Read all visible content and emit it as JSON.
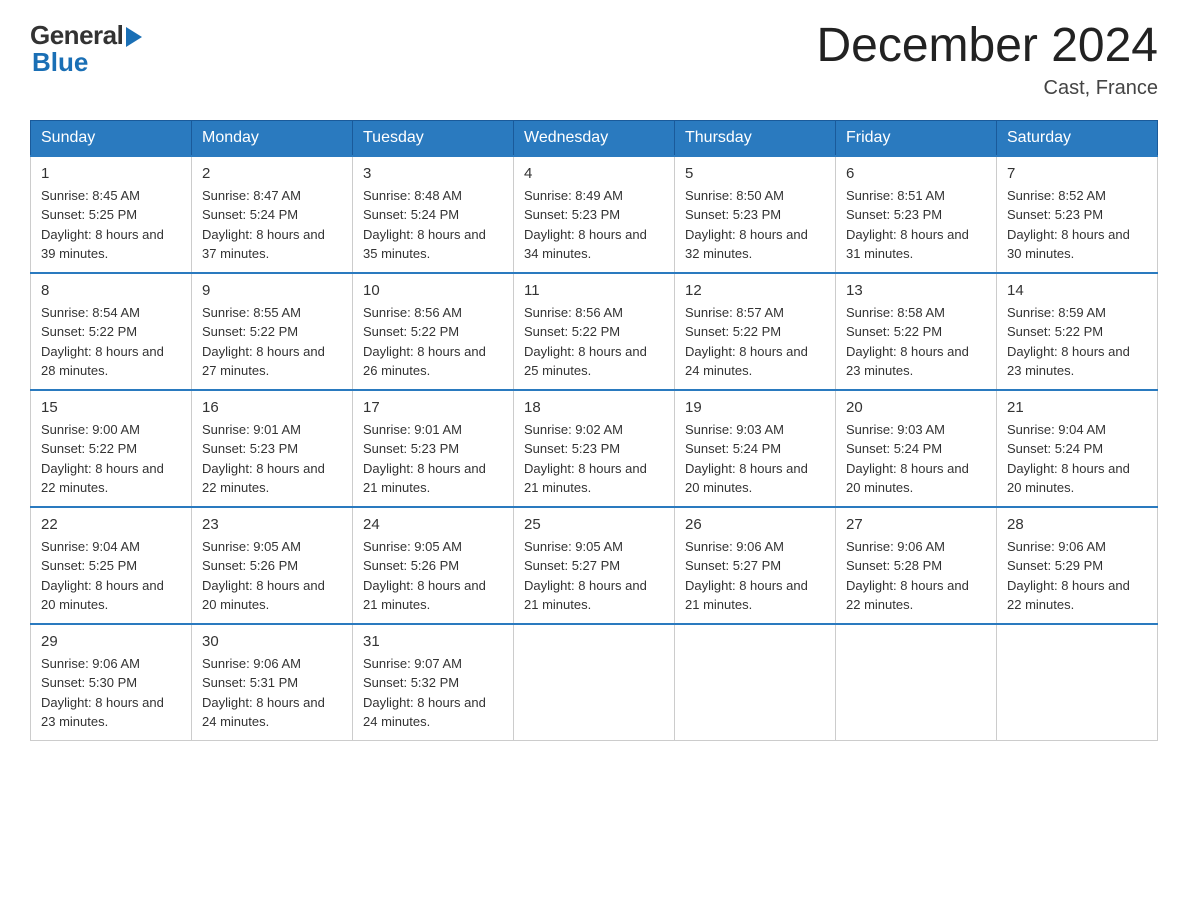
{
  "header": {
    "logo_general": "General",
    "logo_blue": "Blue",
    "month_title": "December 2024",
    "location": "Cast, France"
  },
  "days_of_week": [
    "Sunday",
    "Monday",
    "Tuesday",
    "Wednesday",
    "Thursday",
    "Friday",
    "Saturday"
  ],
  "weeks": [
    [
      {
        "day": "1",
        "sunrise": "8:45 AM",
        "sunset": "5:25 PM",
        "daylight": "8 hours and 39 minutes."
      },
      {
        "day": "2",
        "sunrise": "8:47 AM",
        "sunset": "5:24 PM",
        "daylight": "8 hours and 37 minutes."
      },
      {
        "day": "3",
        "sunrise": "8:48 AM",
        "sunset": "5:24 PM",
        "daylight": "8 hours and 35 minutes."
      },
      {
        "day": "4",
        "sunrise": "8:49 AM",
        "sunset": "5:23 PM",
        "daylight": "8 hours and 34 minutes."
      },
      {
        "day": "5",
        "sunrise": "8:50 AM",
        "sunset": "5:23 PM",
        "daylight": "8 hours and 32 minutes."
      },
      {
        "day": "6",
        "sunrise": "8:51 AM",
        "sunset": "5:23 PM",
        "daylight": "8 hours and 31 minutes."
      },
      {
        "day": "7",
        "sunrise": "8:52 AM",
        "sunset": "5:23 PM",
        "daylight": "8 hours and 30 minutes."
      }
    ],
    [
      {
        "day": "8",
        "sunrise": "8:54 AM",
        "sunset": "5:22 PM",
        "daylight": "8 hours and 28 minutes."
      },
      {
        "day": "9",
        "sunrise": "8:55 AM",
        "sunset": "5:22 PM",
        "daylight": "8 hours and 27 minutes."
      },
      {
        "day": "10",
        "sunrise": "8:56 AM",
        "sunset": "5:22 PM",
        "daylight": "8 hours and 26 minutes."
      },
      {
        "day": "11",
        "sunrise": "8:56 AM",
        "sunset": "5:22 PM",
        "daylight": "8 hours and 25 minutes."
      },
      {
        "day": "12",
        "sunrise": "8:57 AM",
        "sunset": "5:22 PM",
        "daylight": "8 hours and 24 minutes."
      },
      {
        "day": "13",
        "sunrise": "8:58 AM",
        "sunset": "5:22 PM",
        "daylight": "8 hours and 23 minutes."
      },
      {
        "day": "14",
        "sunrise": "8:59 AM",
        "sunset": "5:22 PM",
        "daylight": "8 hours and 23 minutes."
      }
    ],
    [
      {
        "day": "15",
        "sunrise": "9:00 AM",
        "sunset": "5:22 PM",
        "daylight": "8 hours and 22 minutes."
      },
      {
        "day": "16",
        "sunrise": "9:01 AM",
        "sunset": "5:23 PM",
        "daylight": "8 hours and 22 minutes."
      },
      {
        "day": "17",
        "sunrise": "9:01 AM",
        "sunset": "5:23 PM",
        "daylight": "8 hours and 21 minutes."
      },
      {
        "day": "18",
        "sunrise": "9:02 AM",
        "sunset": "5:23 PM",
        "daylight": "8 hours and 21 minutes."
      },
      {
        "day": "19",
        "sunrise": "9:03 AM",
        "sunset": "5:24 PM",
        "daylight": "8 hours and 20 minutes."
      },
      {
        "day": "20",
        "sunrise": "9:03 AM",
        "sunset": "5:24 PM",
        "daylight": "8 hours and 20 minutes."
      },
      {
        "day": "21",
        "sunrise": "9:04 AM",
        "sunset": "5:24 PM",
        "daylight": "8 hours and 20 minutes."
      }
    ],
    [
      {
        "day": "22",
        "sunrise": "9:04 AM",
        "sunset": "5:25 PM",
        "daylight": "8 hours and 20 minutes."
      },
      {
        "day": "23",
        "sunrise": "9:05 AM",
        "sunset": "5:26 PM",
        "daylight": "8 hours and 20 minutes."
      },
      {
        "day": "24",
        "sunrise": "9:05 AM",
        "sunset": "5:26 PM",
        "daylight": "8 hours and 21 minutes."
      },
      {
        "day": "25",
        "sunrise": "9:05 AM",
        "sunset": "5:27 PM",
        "daylight": "8 hours and 21 minutes."
      },
      {
        "day": "26",
        "sunrise": "9:06 AM",
        "sunset": "5:27 PM",
        "daylight": "8 hours and 21 minutes."
      },
      {
        "day": "27",
        "sunrise": "9:06 AM",
        "sunset": "5:28 PM",
        "daylight": "8 hours and 22 minutes."
      },
      {
        "day": "28",
        "sunrise": "9:06 AM",
        "sunset": "5:29 PM",
        "daylight": "8 hours and 22 minutes."
      }
    ],
    [
      {
        "day": "29",
        "sunrise": "9:06 AM",
        "sunset": "5:30 PM",
        "daylight": "8 hours and 23 minutes."
      },
      {
        "day": "30",
        "sunrise": "9:06 AM",
        "sunset": "5:31 PM",
        "daylight": "8 hours and 24 minutes."
      },
      {
        "day": "31",
        "sunrise": "9:07 AM",
        "sunset": "5:32 PM",
        "daylight": "8 hours and 24 minutes."
      },
      null,
      null,
      null,
      null
    ]
  ]
}
